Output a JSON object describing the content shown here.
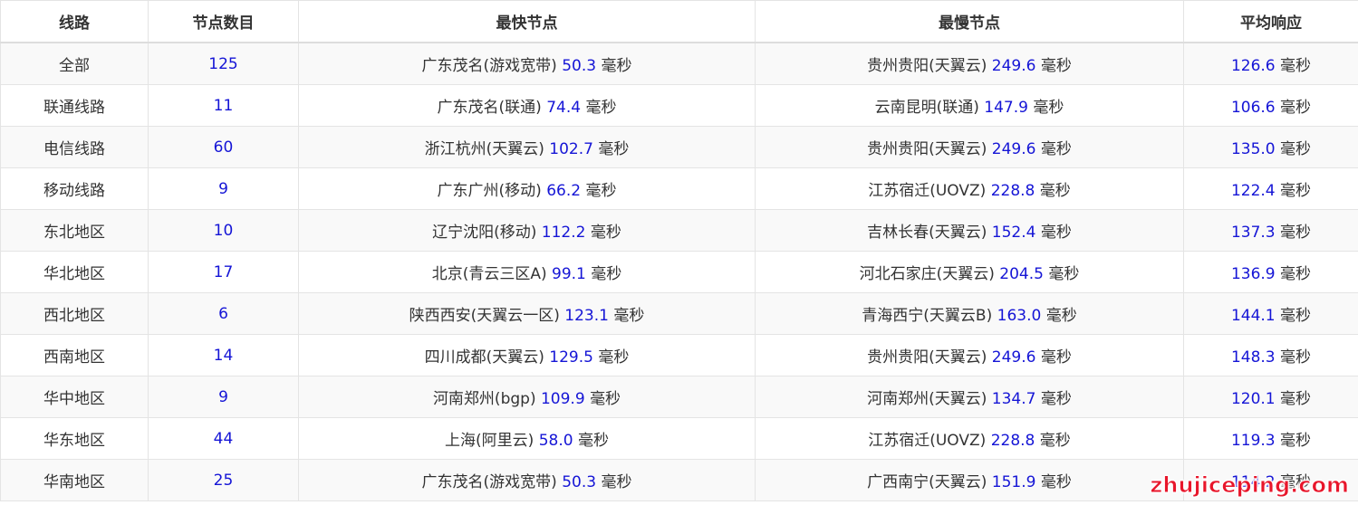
{
  "headers": [
    "线路",
    "节点数目",
    "最快节点",
    "最慢节点",
    "平均响应"
  ],
  "unit": "毫秒",
  "rows": [
    {
      "line": "全部",
      "count": "125",
      "fast_name": "广东茂名(游戏宽带)",
      "fast_val": "50.3",
      "slow_name": "贵州贵阳(天翼云)",
      "slow_val": "249.6",
      "avg": "126.6"
    },
    {
      "line": "联通线路",
      "count": "11",
      "fast_name": "广东茂名(联通)",
      "fast_val": "74.4",
      "slow_name": "云南昆明(联通)",
      "slow_val": "147.9",
      "avg": "106.6"
    },
    {
      "line": "电信线路",
      "count": "60",
      "fast_name": "浙江杭州(天翼云)",
      "fast_val": "102.7",
      "slow_name": "贵州贵阳(天翼云)",
      "slow_val": "249.6",
      "avg": "135.0"
    },
    {
      "line": "移动线路",
      "count": "9",
      "fast_name": "广东广州(移动)",
      "fast_val": "66.2",
      "slow_name": "江苏宿迁(UOVZ)",
      "slow_val": "228.8",
      "avg": "122.4"
    },
    {
      "line": "东北地区",
      "count": "10",
      "fast_name": "辽宁沈阳(移动)",
      "fast_val": "112.2",
      "slow_name": "吉林长春(天翼云)",
      "slow_val": "152.4",
      "avg": "137.3"
    },
    {
      "line": "华北地区",
      "count": "17",
      "fast_name": "北京(青云三区A)",
      "fast_val": "99.1",
      "slow_name": "河北石家庄(天翼云)",
      "slow_val": "204.5",
      "avg": "136.9"
    },
    {
      "line": "西北地区",
      "count": "6",
      "fast_name": "陕西西安(天翼云一区)",
      "fast_val": "123.1",
      "slow_name": "青海西宁(天翼云B)",
      "slow_val": "163.0",
      "avg": "144.1"
    },
    {
      "line": "西南地区",
      "count": "14",
      "fast_name": "四川成都(天翼云)",
      "fast_val": "129.5",
      "slow_name": "贵州贵阳(天翼云)",
      "slow_val": "249.6",
      "avg": "148.3"
    },
    {
      "line": "华中地区",
      "count": "9",
      "fast_name": "河南郑州(bgp)",
      "fast_val": "109.9",
      "slow_name": "河南郑州(天翼云)",
      "slow_val": "134.7",
      "avg": "120.1"
    },
    {
      "line": "华东地区",
      "count": "44",
      "fast_name": "上海(阿里云)",
      "fast_val": "58.0",
      "slow_name": "江苏宿迁(UOVZ)",
      "slow_val": "228.8",
      "avg": "119.3"
    },
    {
      "line": "华南地区",
      "count": "25",
      "fast_name": "广东茂名(游戏宽带)",
      "fast_val": "50.3",
      "slow_name": "广西南宁(天翼云)",
      "slow_val": "151.9",
      "avg": "114.2"
    }
  ],
  "watermark": "zhujiceping.com",
  "colors": {
    "value_blue": "#1515d6",
    "text": "#333333",
    "watermark_red": "#e8162b"
  }
}
